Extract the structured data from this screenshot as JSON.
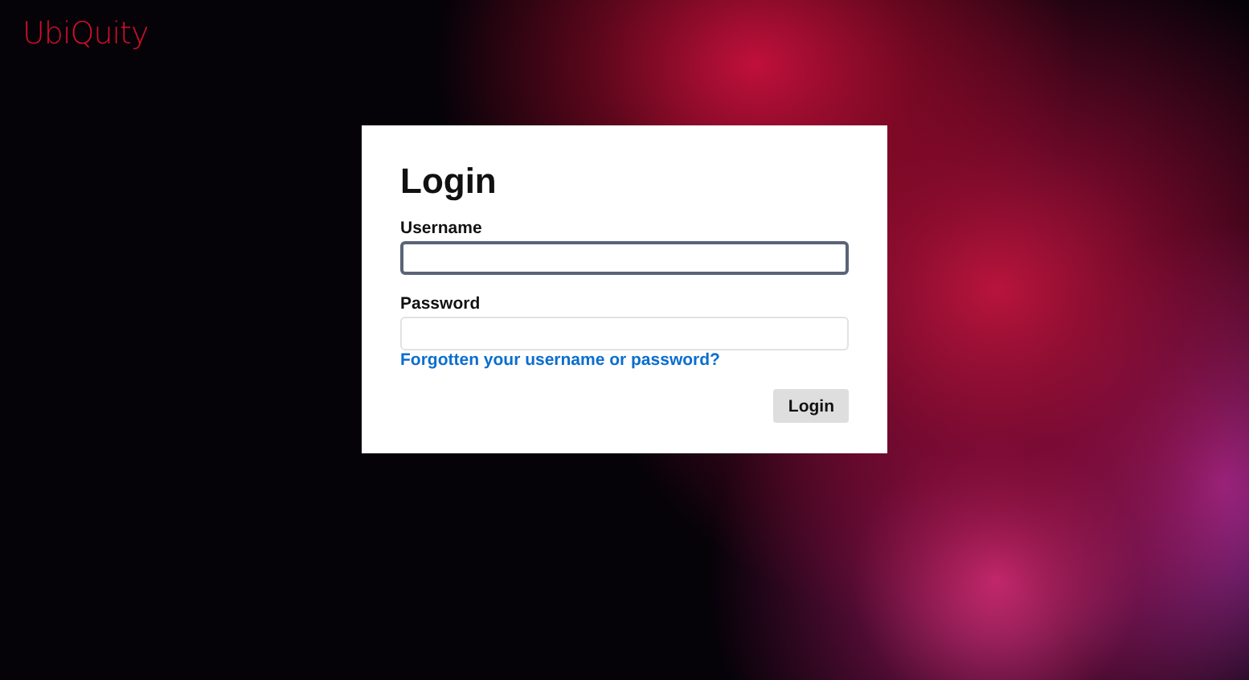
{
  "logo": "UbiQuity",
  "login": {
    "title": "Login",
    "fields": [
      {
        "label": "Username",
        "focused": true
      },
      {
        "label": "Password",
        "focused": false
      }
    ],
    "forgot_link": "Forgotten your username or password?",
    "submit": "Login"
  }
}
